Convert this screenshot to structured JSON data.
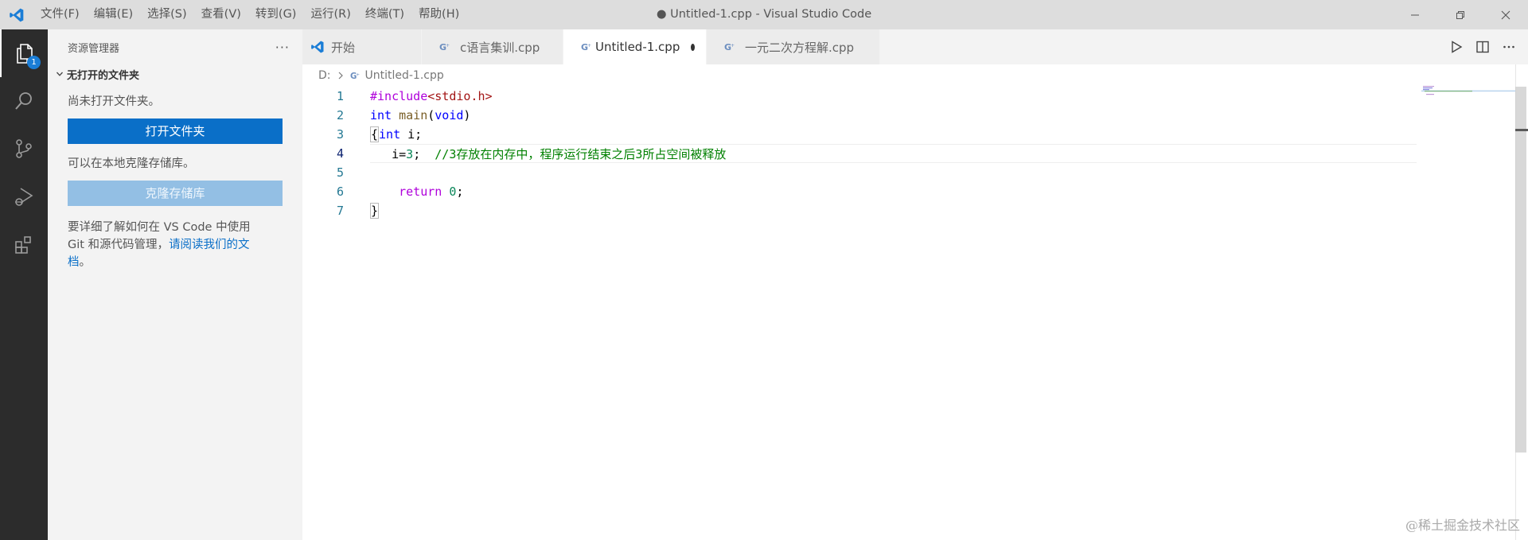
{
  "titlebar": {
    "menu": [
      "文件(F)",
      "编辑(E)",
      "选择(S)",
      "查看(V)",
      "转到(G)",
      "运行(R)",
      "终端(T)",
      "帮助(H)"
    ],
    "window_title": "● Untitled-1.cpp - Visual Studio Code"
  },
  "activitybar": {
    "explorer_badge": "1"
  },
  "sidebar": {
    "title": "资源管理器",
    "more": "···",
    "section": "无打开的文件夹",
    "no_folder_text": "尚未打开文件夹。",
    "open_folder_button": "打开文件夹",
    "clone_text": "可以在本地克隆存储库。",
    "clone_button": "克隆存储库",
    "help_text_1": "要详细了解如何在 VS Code 中使用",
    "help_text_2": "Git 和源代码管理，",
    "help_link_1": "请阅读我们的文",
    "help_link_2": "档",
    "help_end": "。"
  },
  "tabs": [
    {
      "label": "开始",
      "icon": "vscode-icon"
    },
    {
      "label": "c语言集训.cpp",
      "icon": "cpp-file-icon"
    },
    {
      "label": "Untitled-1.cpp",
      "icon": "cpp-file-icon"
    },
    {
      "label": "一元二次方程解.cpp",
      "icon": "cpp-file-icon"
    }
  ],
  "breadcrumb": {
    "drive": "D:",
    "file": "Untitled-1.cpp"
  },
  "editor": {
    "line_numbers": [
      "1",
      "2",
      "3",
      "4",
      "5",
      "6",
      "7"
    ],
    "current_line": "4",
    "code": {
      "l1_pre": "#include",
      "l1_inc": "<stdio.h>",
      "l2_kw": "int",
      "l2_fn": "main",
      "l2_open": "(",
      "l2_kw2": "void",
      "l2_close": ")",
      "l3_brace": "{",
      "l3_kw": "int",
      "l3_rest": " i;",
      "l4_a": "   i=",
      "l4_num": "3",
      "l4_b": ";  ",
      "l4_cmt": "//3存放在内存中，程序运行结束之后3所占空间被释放",
      "l6_indent": "    ",
      "l6_kw": "return",
      "l6_sp": " ",
      "l6_num": "0",
      "l6_end": ";",
      "l7_brace": "}"
    }
  },
  "watermark": "@稀土掘金技术社区",
  "colors": {
    "accent": "#0a6fc8",
    "activitybar": "#2c2c2c",
    "sidebar": "#f3f3f3"
  }
}
